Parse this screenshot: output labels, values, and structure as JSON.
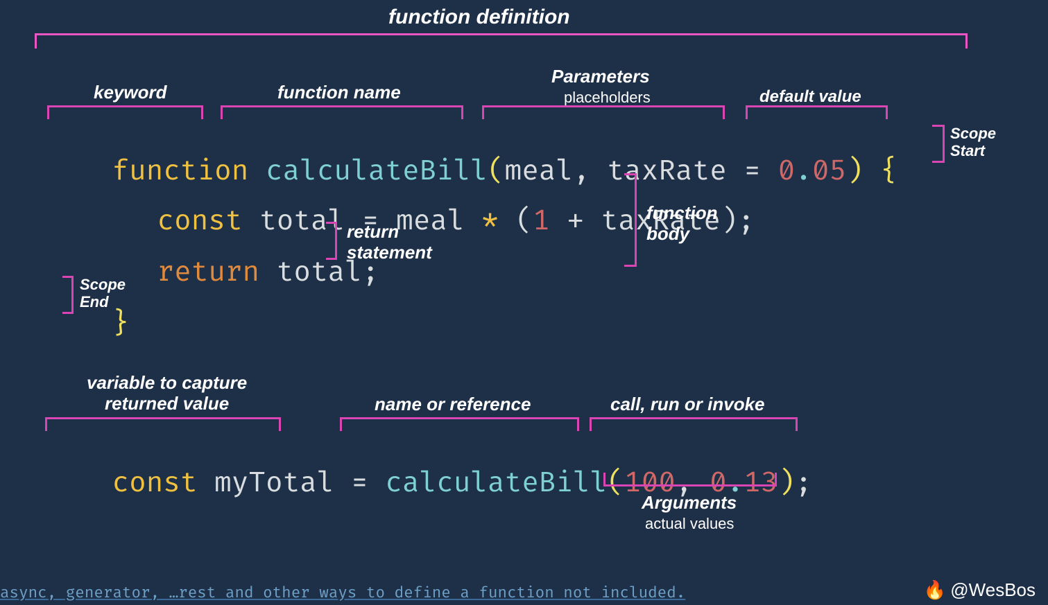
{
  "labels": {
    "function_definition": "function definition",
    "keyword": "keyword",
    "function_name": "function name",
    "parameters": "Parameters",
    "parameters_sub": "placeholders",
    "default_value": "default value",
    "scope_start": "Scope\nStart",
    "function_body": "function\nbody",
    "return_statement": "return\nstatement",
    "scope_end": "Scope\nEnd",
    "variable_capture": "variable to capture\nreturned value",
    "name_or_reference": "name or reference",
    "call_run_invoke": "call, run or invoke",
    "arguments": "Arguments",
    "arguments_sub": "actual values"
  },
  "code": {
    "l1": {
      "function_kw": "function",
      "name": "calculateBill",
      "lparen": "(",
      "p1": "meal",
      "comma1": ",",
      "p2": "taxRate",
      "eq": "=",
      "num0": "0",
      "dot": ".",
      "num05": "05",
      "rparen": ")",
      "lbrace": "{"
    },
    "l2": {
      "const_kw": "const",
      "total": "total",
      "eq": "=",
      "meal": "meal",
      "star": "*",
      "lparen": "(",
      "one": "1",
      "plus": "+",
      "taxRate": "taxRate",
      "rparen": ")",
      "semi": ";"
    },
    "l3": {
      "return_kw": "return",
      "total": "total",
      "semi": ";"
    },
    "l4": {
      "rbrace": "}"
    },
    "l5": {
      "const_kw": "const",
      "myTotal": "myTotal",
      "eq": "=",
      "name": "calculateBill",
      "lparen": "(",
      "arg1": "100",
      "comma": ",",
      "arg2a": "0",
      "dot": ".",
      "arg2b": "13",
      "rparen": ")",
      "semi": ";"
    }
  },
  "footer": "async, generator, …rest and other ways to define a function not included.",
  "credit": "@WesBos",
  "fire_icon": "🔥"
}
